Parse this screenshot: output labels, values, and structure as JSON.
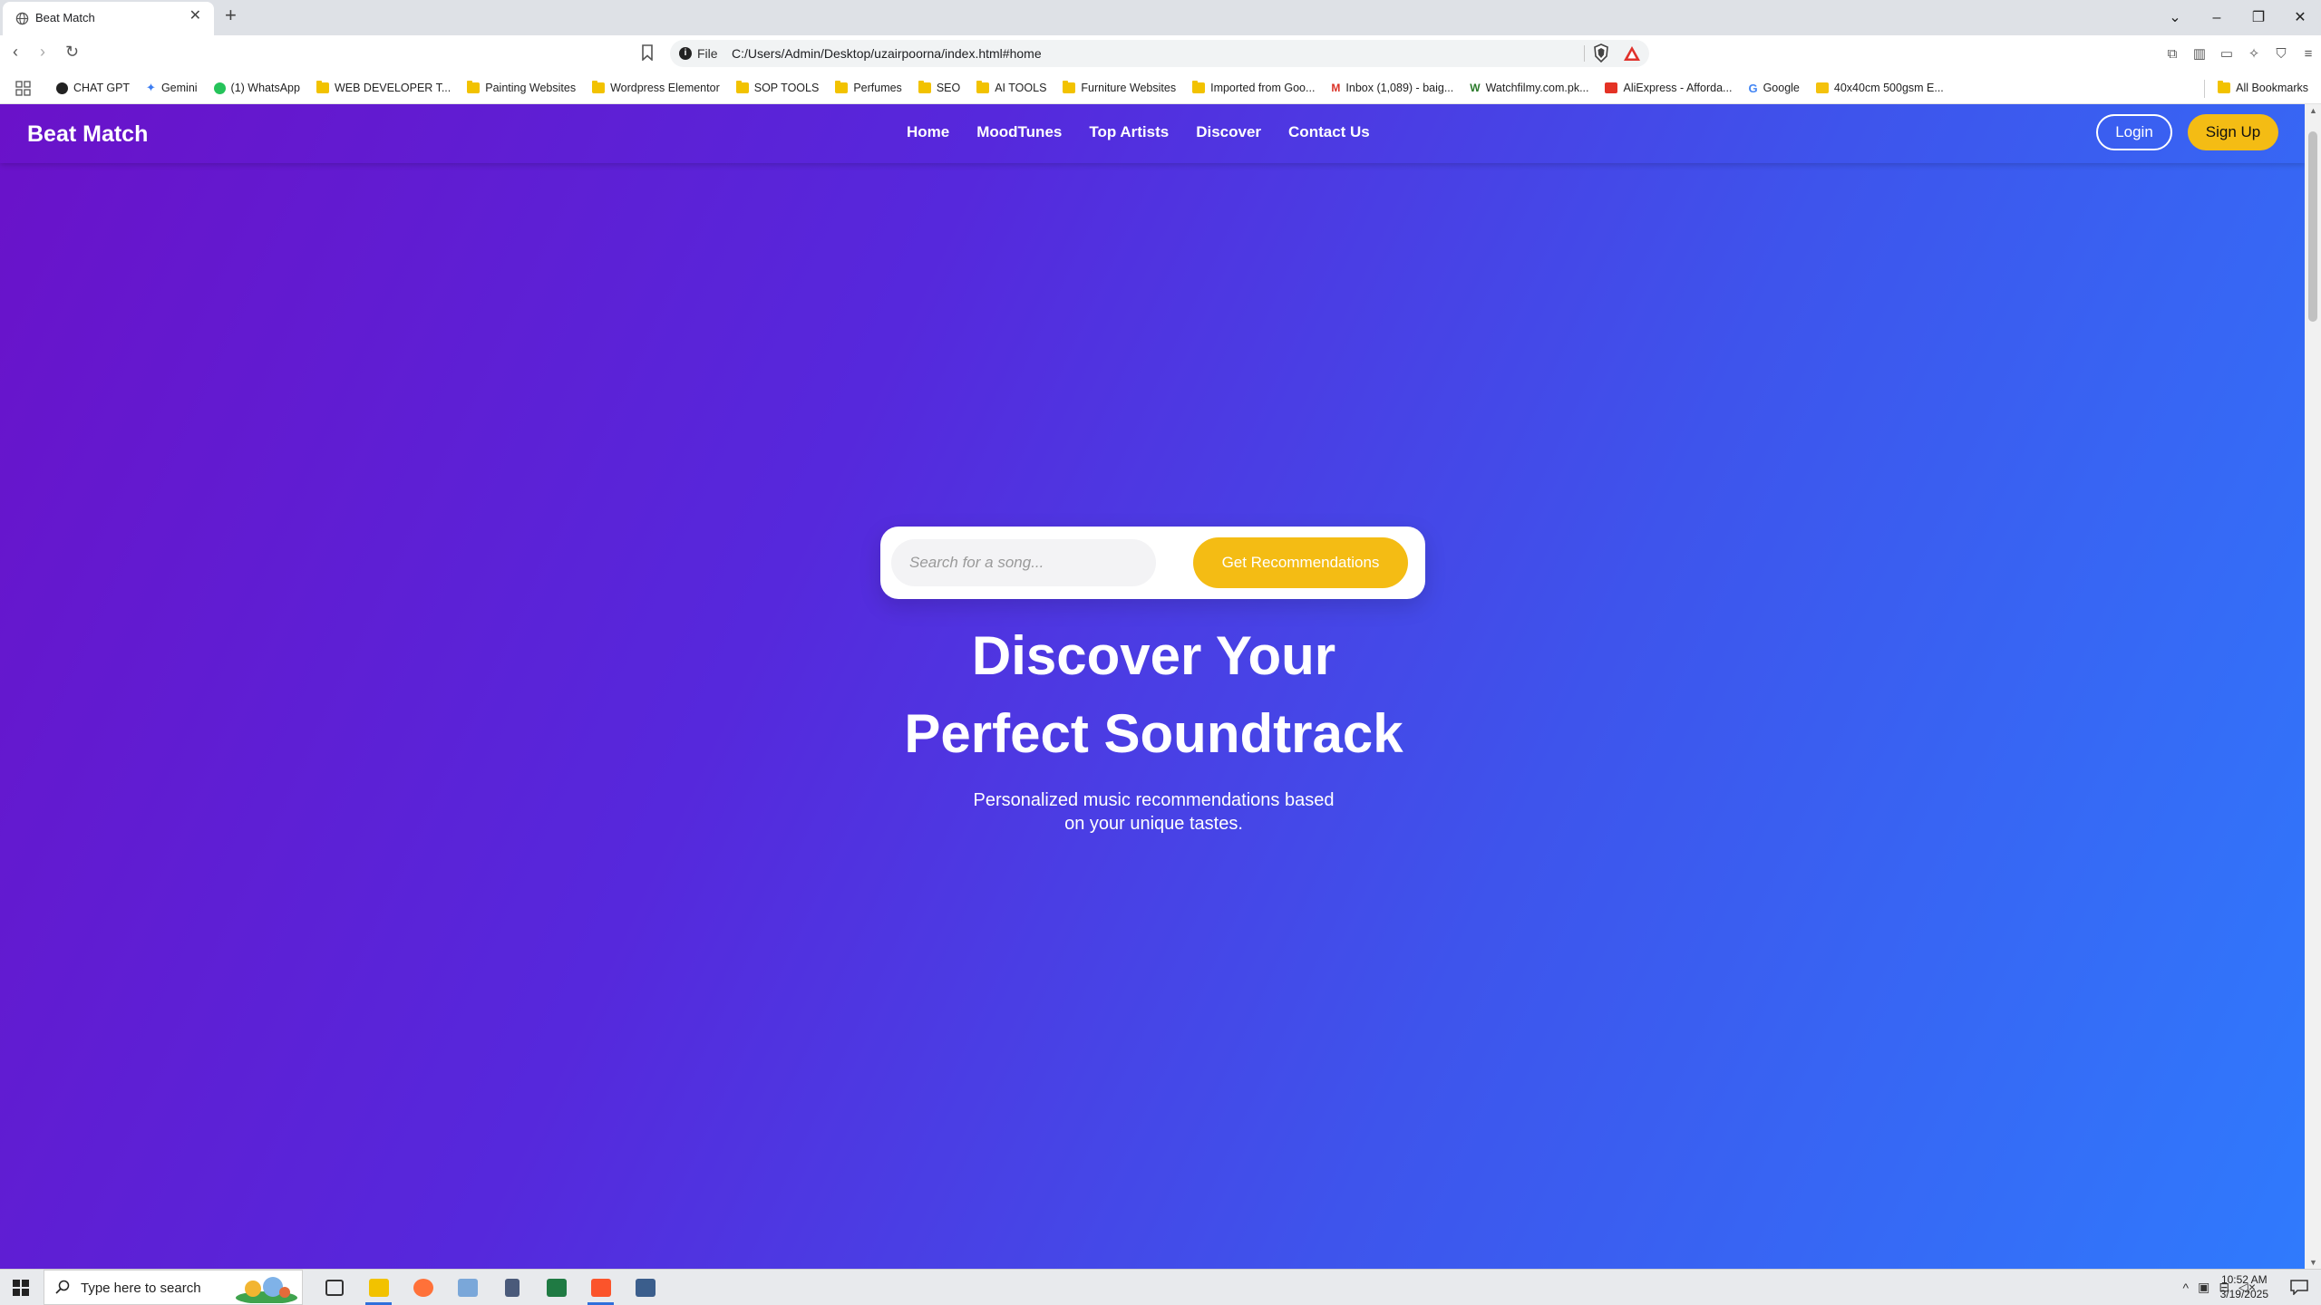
{
  "browser": {
    "tab_title": "Beat Match",
    "url_scheme": "File",
    "url": "C:/Users/Admin/Desktop/uzairpoorna/index.html#home",
    "bookmarks": [
      "CHAT GPT",
      "Gemini",
      "(1) WhatsApp",
      "WEB DEVELOPER T...",
      "Painting Websites",
      "Wordpress Elementor",
      "SOP TOOLS",
      "Perfumes",
      "SEO",
      "AI TOOLS",
      "Furniture Websites",
      "Imported from Goo...",
      "Inbox (1,089) - baig...",
      "Watchfilmy.com.pk...",
      "AliExpress - Afforda...",
      "Google",
      "40x40cm 500gsm E..."
    ],
    "all_bookmarks": "All Bookmarks"
  },
  "site": {
    "logo": "Beat Match",
    "nav": [
      "Home",
      "MoodTunes",
      "Top Artists",
      "Discover",
      "Contact Us"
    ],
    "login": "Login",
    "signup": "Sign Up",
    "search_placeholder": "Search for a song...",
    "recommend_button": "Get Recommendations",
    "hero_title_line1": "Discover Your",
    "hero_title_line2": "Perfect Soundtrack",
    "hero_sub_line1": "Personalized music recommendations based",
    "hero_sub_line2": "on your unique tastes.",
    "colors": {
      "gradient_start": "#6a12c9",
      "gradient_end": "#2f7bfd",
      "accent_yellow": "#f4bc14"
    }
  },
  "taskbar": {
    "search_placeholder": "Type here to search",
    "time": "10:52 AM",
    "date": "3/19/2025"
  }
}
